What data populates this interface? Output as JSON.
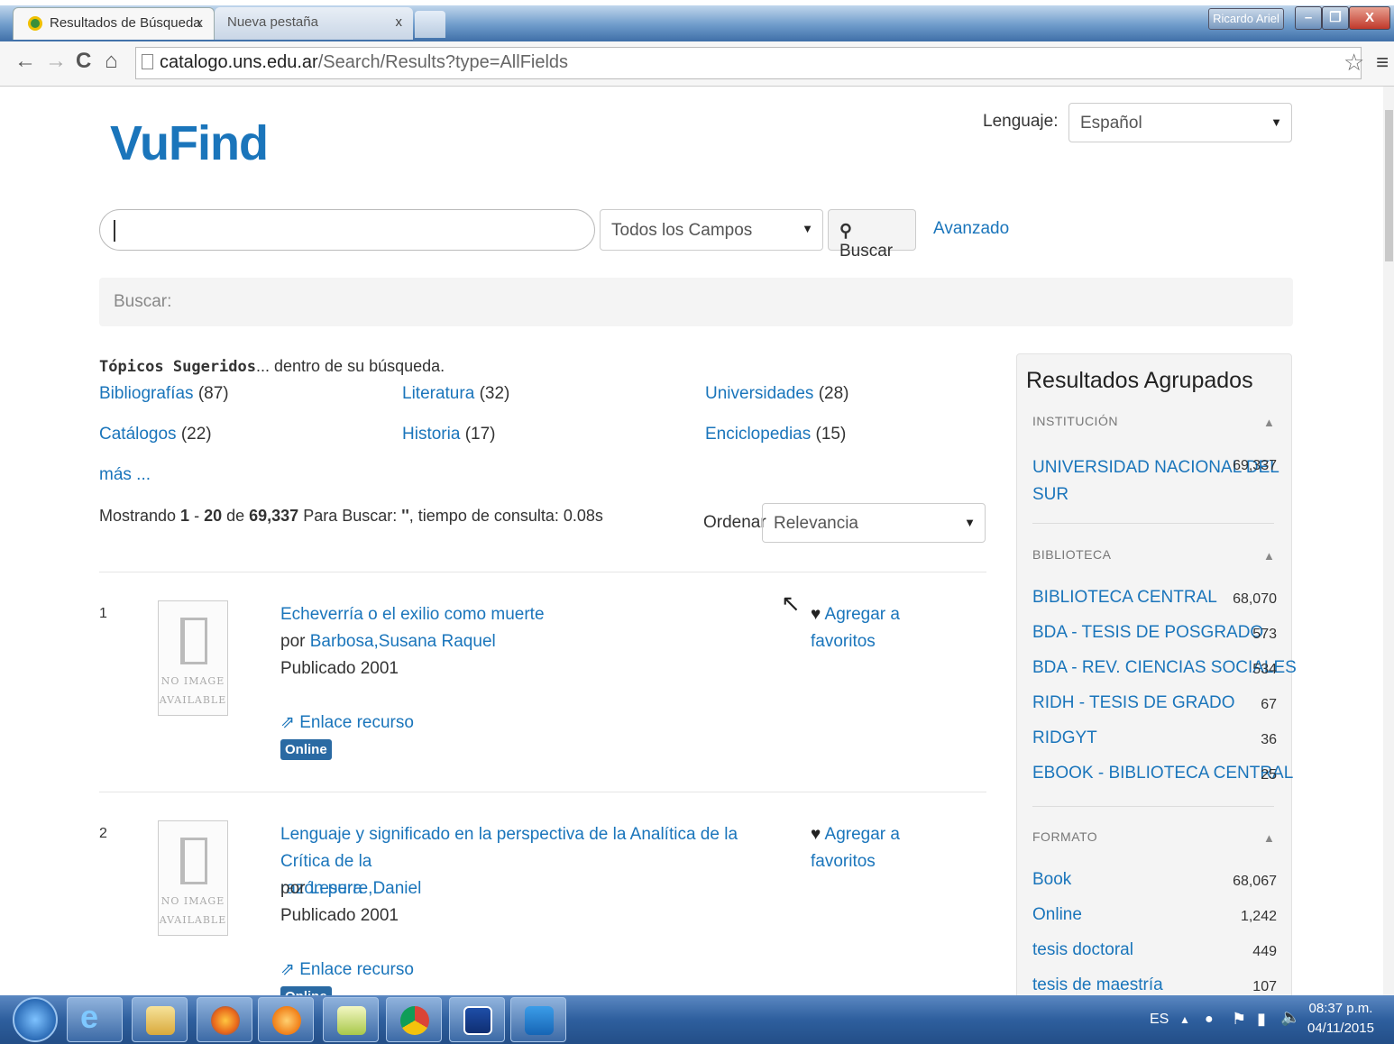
{
  "browser": {
    "tabs": [
      {
        "label": "Resultados de Búsqueda",
        "close": "x"
      },
      {
        "label": "Nueva pestaña",
        "close": "x"
      }
    ],
    "user": "Ricardo Ariel",
    "window_buttons": {
      "minimize": "–",
      "maximize": "❐",
      "close": "X"
    },
    "url_host": "catalogo.uns.edu.ar",
    "url_path": "/Search/Results?type=AllFields",
    "icons": [
      "back-icon",
      "forward-icon",
      "reload-icon",
      "home-icon",
      "page-icon",
      "star-icon",
      "menu-icon"
    ]
  },
  "header": {
    "logo": "VuFind",
    "language_label": "Lenguaje:",
    "language_value": "Español"
  },
  "search": {
    "input_value": "",
    "field_select": "Todos los Campos",
    "search_button": "Buscar",
    "advanced_link": "Avanzado",
    "breadcrumb": "Buscar:"
  },
  "topics": {
    "heading_bold": "Tópicos Sugeridos",
    "heading_rest": "... dentro de su búsqueda.",
    "items": [
      {
        "label": "Bibliografías",
        "count": "(87)"
      },
      {
        "label": "Literatura",
        "count": "(32)"
      },
      {
        "label": "Universidades",
        "count": "(28)"
      },
      {
        "label": "Catálogos",
        "count": "(22)"
      },
      {
        "label": "Historia",
        "count": "(17)"
      },
      {
        "label": "Enciclopedias",
        "count": "(15)"
      }
    ],
    "more": "más ..."
  },
  "results_summary": {
    "prefix": "Mostrando ",
    "start": "1",
    "dash": " - ",
    "end": "20",
    "of": " de ",
    "total": "69,337",
    "query_text": " Para Buscar: ",
    "query": "''",
    "time": ", tiempo de consulta: 0.08s"
  },
  "sort": {
    "label": "Ordenar",
    "value": "Relevancia"
  },
  "results": [
    {
      "number": "1",
      "no_image": "NO IMAGE AVAILABLE",
      "title_lines": [
        "Echeverría o el exilio como muerte"
      ],
      "author_prefix": "por ",
      "author": "Barbosa,Susana Raquel",
      "published": "Publicado 2001",
      "link": "Enlace recurso",
      "badge": "Online",
      "favorite": [
        "Agregar a",
        "favoritos"
      ]
    },
    {
      "number": "2",
      "no_image": "NO IMAGE AVAILABLE",
      "title_lines": [
        "Lenguaje y significado en la perspectiva de la Analítica de la Crítica de la",
        "razón pura"
      ],
      "author_prefix": "por ",
      "author": "Leserre,Daniel",
      "published": "Publicado 2001",
      "link": "Enlace recurso",
      "badge": "Online",
      "favorite": [
        "Agregar a",
        "favoritos"
      ]
    }
  ],
  "sidebar": {
    "title": "Resultados Agrupados",
    "facets": [
      {
        "heading": "INSTITUCIÓN",
        "items": [
          {
            "label_lines": [
              "UNIVERSIDAD NACIONAL DEL",
              "SUR"
            ],
            "count": "69,337"
          }
        ]
      },
      {
        "heading": "BIBLIOTECA",
        "items": [
          {
            "label_lines": [
              "BIBLIOTECA CENTRAL"
            ],
            "count": "68,070"
          },
          {
            "label_lines": [
              "BDA - TESIS DE POSGRADO"
            ],
            "count": "573"
          },
          {
            "label_lines": [
              "BDA - REV. CIENCIAS SOCIALES"
            ],
            "count": "534"
          },
          {
            "label_lines": [
              "RIDH - TESIS DE GRADO"
            ],
            "count": "67"
          },
          {
            "label_lines": [
              "RIDGYT"
            ],
            "count": "36"
          },
          {
            "label_lines": [
              "EBOOK - BIBLIOTECA CENTRAL"
            ],
            "count": "25"
          }
        ]
      },
      {
        "heading": "FORMATO",
        "items": [
          {
            "label_lines": [
              "Book"
            ],
            "count": "68,067"
          },
          {
            "label_lines": [
              "Online"
            ],
            "count": "1,242"
          },
          {
            "label_lines": [
              "tesis doctoral"
            ],
            "count": "449"
          },
          {
            "label_lines": [
              "tesis de maestría"
            ],
            "count": "107"
          }
        ]
      }
    ]
  },
  "taskbar": {
    "apps": [
      "internet-explorer-icon",
      "file-explorer-icon",
      "firefox-icon",
      "media-player-icon",
      "notepad-icon",
      "chrome-icon",
      "save-disk-icon",
      "teamviewer-icon"
    ],
    "lang": "ES",
    "time": "08:37 p.m.",
    "date": "04/11/2015"
  },
  "colors": {
    "link": "#1a75bb",
    "badge": "#2a6aa3",
    "taskbar": "#2e5f9e"
  }
}
